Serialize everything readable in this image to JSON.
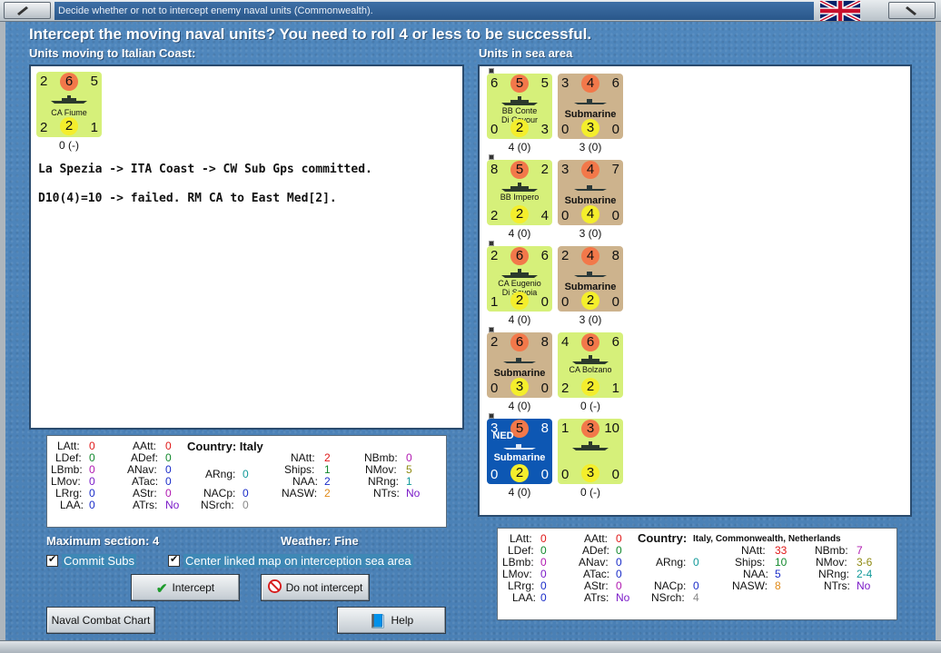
{
  "window": {
    "title": "Decide whether or not to intercept enemy naval units (Commonwealth)."
  },
  "heading": "Intercept the moving naval units?  You need to roll 4 or less to be successful.",
  "left_label": "Units moving to Italian Coast:",
  "right_label": "Units in sea area",
  "moving_unit": {
    "tl": "2",
    "top": "6",
    "tr": "5",
    "name": "CA Fiume",
    "bl": "2",
    "bot": "2",
    "br": "1",
    "under": "0 (-)"
  },
  "log_lines": [
    "La Spezia -> ITA Coast -> CW Sub Gps committed.",
    "D10(4)=10 -> failed.  RM CA to East Med[2]."
  ],
  "sea_units": [
    {
      "tl": "6",
      "top": "5",
      "tr": "5",
      "name1": "BB Conte",
      "name2": "Di Cavour",
      "bl": "0",
      "bot": "2",
      "br": "3",
      "under": "4 (0)",
      "style": "green"
    },
    {
      "tl": "3",
      "top": "4",
      "tr": "6",
      "name1": "Submarine",
      "name2": "",
      "bl": "0",
      "bot": "3",
      "br": "0",
      "under": "3 (0)",
      "style": "tan"
    },
    {
      "tl": "8",
      "top": "5",
      "tr": "2",
      "name1": "BB Impero",
      "name2": "",
      "bl": "2",
      "bot": "2",
      "br": "4",
      "under": "4 (0)",
      "style": "green"
    },
    {
      "tl": "3",
      "top": "4",
      "tr": "7",
      "name1": "Submarine",
      "name2": "",
      "bl": "0",
      "bot": "4",
      "br": "0",
      "under": "3 (0)",
      "style": "tan"
    },
    {
      "tl": "2",
      "top": "6",
      "tr": "6",
      "name1": "CA Eugenio",
      "name2": "Di Savoia",
      "bl": "1",
      "bot": "2",
      "br": "0",
      "under": "4 (0)",
      "style": "green"
    },
    {
      "tl": "2",
      "top": "4",
      "tr": "8",
      "name1": "Submarine",
      "name2": "",
      "bl": "0",
      "bot": "2",
      "br": "0",
      "under": "3 (0)",
      "style": "tan"
    },
    {
      "tl": "2",
      "top": "6",
      "tr": "8",
      "name1": "Submarine",
      "name2": "",
      "bl": "0",
      "bot": "3",
      "br": "0",
      "under": "4 (0)",
      "style": "tan"
    },
    {
      "tl": "4",
      "top": "6",
      "tr": "6",
      "name1": "CA Bolzano",
      "name2": "",
      "bl": "2",
      "bot": "2",
      "br": "1",
      "under": "0 (-)",
      "style": "green"
    },
    {
      "tl": "3",
      "top": "5",
      "tr": "8",
      "name1": "Submarine",
      "name2": "NED",
      "bl": "0",
      "bot": "2",
      "br": "0",
      "under": "4 (0)",
      "style": "blue"
    },
    {
      "tl": "1",
      "top": "3",
      "tr": "10",
      "name1": "",
      "name2": "",
      "bl": "0",
      "bot": "3",
      "br": "0",
      "under": "0 (-)",
      "style": "green"
    }
  ],
  "left_stats": {
    "country_label": "Country: Italy",
    "LAtt": "0",
    "LDef": "0",
    "LBmb": "0",
    "LMov": "0",
    "LRrg": "0",
    "LAA": "0",
    "AAtt": "0",
    "ADef": "0",
    "ANav": "0",
    "ATac": "0",
    "AStr": "0",
    "ATrs": "No",
    "ARng": "0",
    "NACp": "0",
    "NSrch": "0",
    "NAtt": "2",
    "Ships": "1",
    "NAA": "2",
    "NASW": "2",
    "NBmb": "0",
    "NMov": "5",
    "NRng": "1",
    "NTrs": "No"
  },
  "right_stats": {
    "country_label": "Country:",
    "country_value": "Italy, Commonwealth, Netherlands",
    "LAtt": "0",
    "LDef": "0",
    "LBmb": "0",
    "LMov": "0",
    "LRrg": "0",
    "LAA": "0",
    "AAtt": "0",
    "ADef": "0",
    "ANav": "0",
    "ATac": "0",
    "AStr": "0",
    "ATrs": "No",
    "ARng": "0",
    "NACp": "0",
    "NSrch": "4",
    "NAtt": "33",
    "Ships": "10",
    "NAA": "5",
    "NASW": "8",
    "NBmb": "7",
    "NMov": "3-6",
    "NRng": "2-4",
    "NTrs": "No"
  },
  "max_section": "Maximum section: 4",
  "weather": "Weather:  Fine",
  "commit_subs": "Commit Subs",
  "center_map": "Center linked map on interception sea area",
  "buttons": {
    "intercept": "Intercept",
    "do_not_intercept": "Do not intercept",
    "naval_chart": "Naval Combat Chart",
    "help": "Help"
  },
  "colors": {
    "green_counter": "#d6f07a",
    "tan_counter": "#cdb38d",
    "ned_counter": "#0d57b3"
  }
}
